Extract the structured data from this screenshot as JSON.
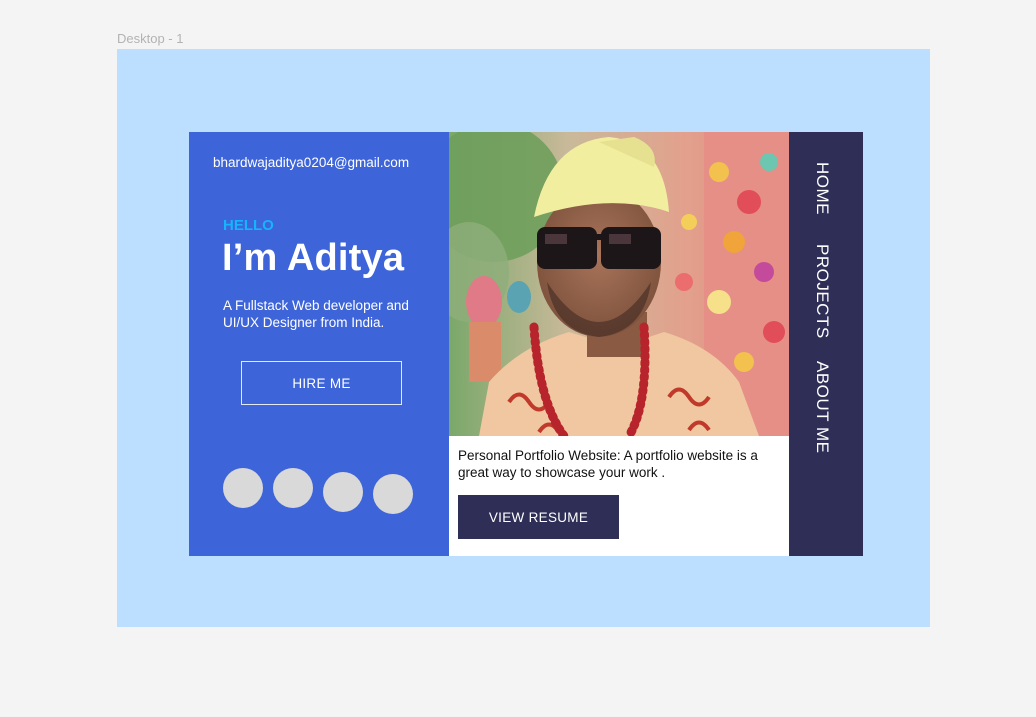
{
  "frame": {
    "label": "Desktop - 1"
  },
  "profile": {
    "email": "bhardwajaditya0204@gmail.com",
    "greeting": "HELLO",
    "name": "I’m Aditya",
    "tagline": "A Fullstack Web developer and UI/UX Designer from India.",
    "hire_label": "HIRE ME",
    "social_icons": [
      "social-icon-1",
      "social-icon-2",
      "social-icon-3",
      "social-icon-4"
    ]
  },
  "project": {
    "description": "Personal Portfolio Website: A portfolio website is a great way to showcase your work .",
    "resume_label": "VIEW RESUME"
  },
  "nav": {
    "home": "HOME",
    "projects": "PROJECTS",
    "about": "ABOUT ME"
  },
  "colors": {
    "canvas": "#f4f4f4",
    "frame": "#bcdfff",
    "left_panel": "#3d64d8",
    "accent": "#17b3ff",
    "dark": "#2e2e57",
    "placeholder": "#d9d9d9"
  }
}
